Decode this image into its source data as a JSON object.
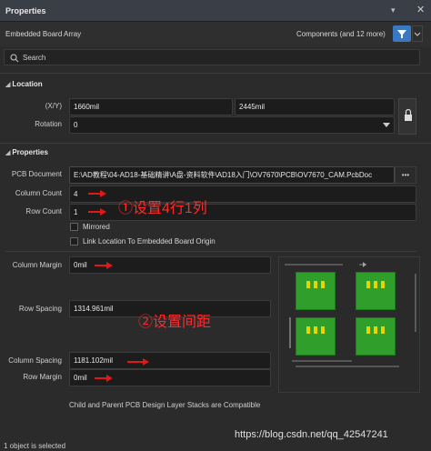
{
  "panel": {
    "title": "Properties",
    "pin_icon": "pin-icon",
    "close_icon": "close-icon"
  },
  "header": {
    "object_type": "Embedded Board Array",
    "filter_summary": "Components (and 12 more)"
  },
  "search": {
    "placeholder": "Search"
  },
  "location": {
    "section_title": "Location",
    "xy_label": "(X/Y)",
    "x_value": "1660mil",
    "y_value": "2445mil",
    "rotation_label": "Rotation",
    "rotation_value": "0"
  },
  "properties": {
    "section_title": "Properties",
    "pcb_document_label": "PCB Document",
    "pcb_document_value": "E:\\AD教程\\04-AD18-基础精讲\\A盘-资料软件\\AD18入门\\OV7670\\PCB\\OV7670_CAM.PcbDoc",
    "browse_label": "•••",
    "column_count_label": "Column Count",
    "column_count_value": "4",
    "row_count_label": "Row Count",
    "row_count_value": "1",
    "mirrored_label": "Mirrored",
    "link_location_label": "Link Location To Embedded Board Origin",
    "column_margin_label": "Column Margin",
    "column_margin_value": "0mil",
    "row_spacing_label": "Row Spacing",
    "row_spacing_value": "1314.961mil",
    "column_spacing_label": "Column Spacing",
    "column_spacing_value": "1181.102mil",
    "row_margin_label": "Row Margin",
    "row_margin_value": "0mil",
    "compat_text": "Child and Parent PCB Design Layer Stacks are Compatible"
  },
  "annotations": {
    "set_grid": "①设置4行1列",
    "set_spacing": "②设置间距"
  },
  "status": {
    "text": "1 object is selected"
  },
  "watermark": "https://blog.csdn.net/qq_42547241",
  "colors": {
    "accent": "#3b78c2",
    "annotation_red": "#ff2a2a",
    "board_green": "#2f9e2a"
  }
}
